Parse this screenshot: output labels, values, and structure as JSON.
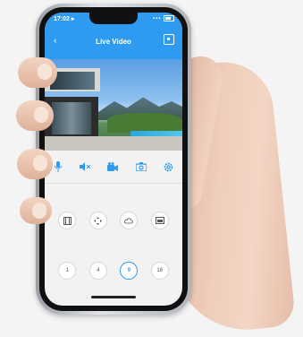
{
  "status_bar": {
    "time": "17:02 ▸",
    "signal": "▪▪▪"
  },
  "header": {
    "back_glyph": "‹",
    "title": "Live Video"
  },
  "toolbar": {
    "icons": [
      "mic-icon",
      "mute-icon",
      "record-icon",
      "camera-icon",
      "settings-icon"
    ]
  },
  "controls": {
    "icons": [
      "film-icon",
      "move-icon",
      "cloud-icon",
      "storage-icon"
    ],
    "grid_options": [
      "1",
      "4",
      "9",
      "16"
    ],
    "selected_grid": "9"
  },
  "colors": {
    "accent": "#2f9bf0",
    "background": "#f2f2f2"
  }
}
